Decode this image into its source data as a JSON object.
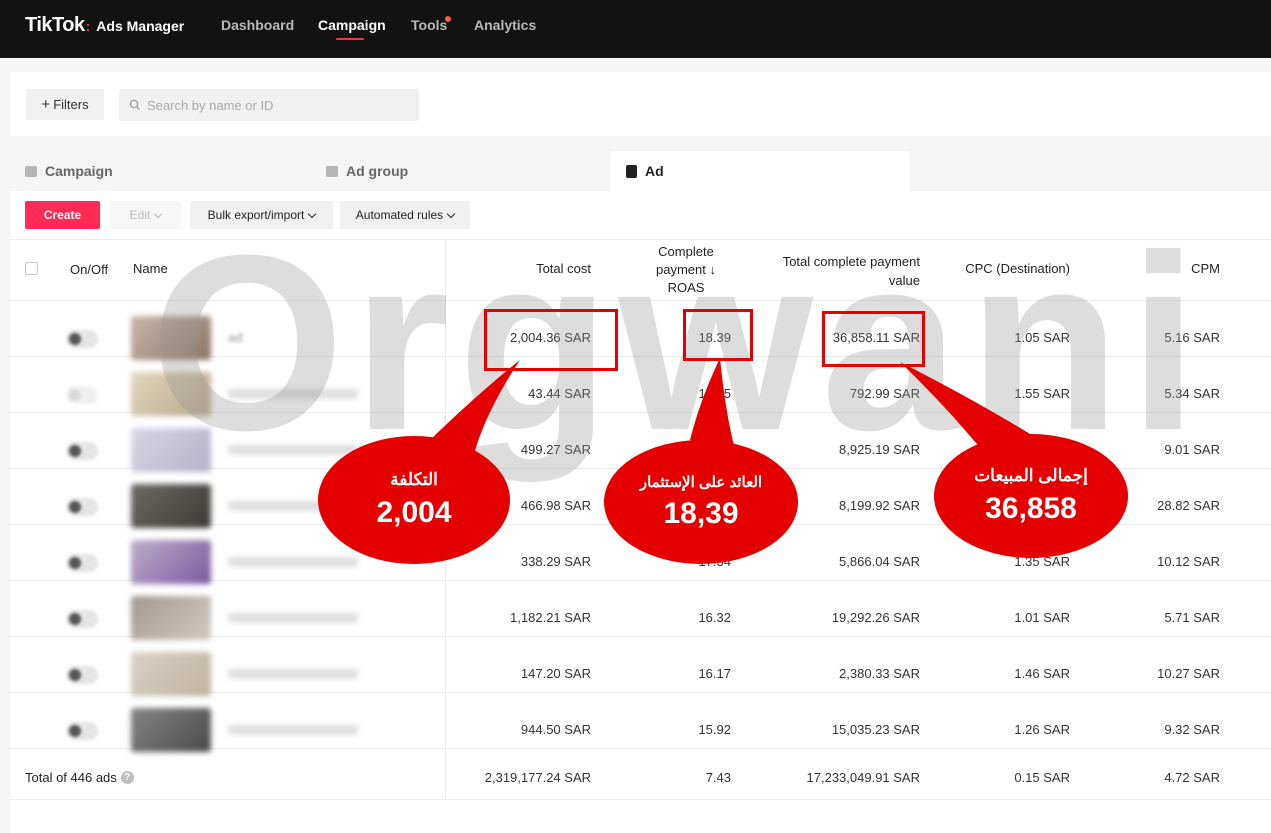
{
  "brand": {
    "main": "TikTok",
    "sub": "Ads Manager"
  },
  "nav": {
    "items": [
      "Dashboard",
      "Campaign",
      "Tools",
      "Analytics"
    ],
    "active": "Campaign"
  },
  "toolbar": {
    "filters_label": "Filters",
    "search_placeholder": "Search by name or ID"
  },
  "tabs": [
    "Campaign",
    "Ad group",
    "Ad"
  ],
  "actions": {
    "create": "Create",
    "edit": "Edit",
    "bulk": "Bulk export/import",
    "rules": "Automated rules"
  },
  "table": {
    "headers": {
      "onoff": "On/Off",
      "name": "Name",
      "cost": "Total cost",
      "roas_l1": "Complete",
      "roas_l2": "payment ↓",
      "roas_l3": "ROAS",
      "value_l1": "Total complete payment",
      "value_l2": "value",
      "cpc": "CPC (Destination)",
      "cpm": "CPM"
    },
    "rows": [
      {
        "name": "ad",
        "cost": "2,004.36 SAR",
        "roas": "18.39",
        "value": "36,858.11 SAR",
        "cpc": "1.05 SAR",
        "cpm": "5.16 SAR"
      },
      {
        "name": "",
        "cost": "43.44 SAR",
        "roas": "18.25",
        "value": "792.99 SAR",
        "cpc": "1.55 SAR",
        "cpm": "5.34 SAR"
      },
      {
        "name": "",
        "cost": "499.27 SAR",
        "roas": "",
        "value": "8,925.19 SAR",
        "cpc": "",
        "cpm": "9.01 SAR"
      },
      {
        "name": "",
        "cost": "466.98 SAR",
        "roas": "",
        "value": "8,199.92 SAR",
        "cpc": "",
        "cpm": "28.82 SAR"
      },
      {
        "name": "",
        "cost": "338.29 SAR",
        "roas": "17.34",
        "value": "5,866.04 SAR",
        "cpc": "1.35 SAR",
        "cpm": "10.12 SAR"
      },
      {
        "name": "",
        "cost": "1,182.21 SAR",
        "roas": "16.32",
        "value": "19,292.26 SAR",
        "cpc": "1.01 SAR",
        "cpm": "5.71 SAR"
      },
      {
        "name": "",
        "cost": "147.20 SAR",
        "roas": "16.17",
        "value": "2,380.33 SAR",
        "cpc": "1.46 SAR",
        "cpm": "10.27 SAR"
      },
      {
        "name": "",
        "cost": "944.50 SAR",
        "roas": "15.92",
        "value": "15,035.23 SAR",
        "cpc": "1.26 SAR",
        "cpm": "9.32 SAR"
      }
    ],
    "total": {
      "label": "Total of 446 ads",
      "cost": "2,319,177.24 SAR",
      "roas": "7.43",
      "value": "17,233,049.91 SAR",
      "cpc": "0.15 SAR",
      "cpm": "4.72 SAR"
    }
  },
  "watermark": "Orgwani",
  "annotations": [
    {
      "label": "التكلفة",
      "value": "2,004"
    },
    {
      "label": "العائد على الإستثمار",
      "value": "18,39"
    },
    {
      "label": "إجمالى المبيعات",
      "value": "36,858"
    }
  ],
  "colors": {
    "accent": "#fe2c55",
    "annotation": "#e50000",
    "nav_bg": "#121212"
  }
}
